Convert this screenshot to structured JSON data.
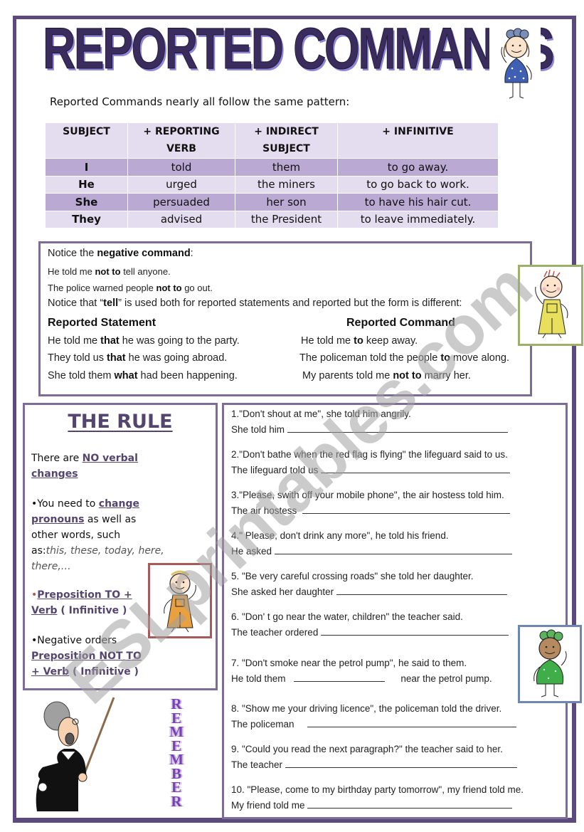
{
  "title": "REPORTED COMMANDS",
  "intro": "Reported Commands nearly all follow the same pattern:",
  "pattern_table": {
    "headers": [
      "SUBJECT",
      "+ REPORTING VERB",
      "+ INDIRECT SUBJECT",
      "+ INFINITIVE"
    ],
    "rows": [
      [
        "I",
        "told",
        "them",
        "to go away."
      ],
      [
        "He",
        "urged",
        "the miners",
        "to go back to work."
      ],
      [
        "She",
        "persuaded",
        "her son",
        "to have his hair cut."
      ],
      [
        "They",
        "advised",
        "the President",
        "to leave immediately."
      ]
    ]
  },
  "notice": {
    "negative_intro_pre": "Notice the ",
    "negative_intro_bold": "negative command",
    "negative_intro_post": ":",
    "example1_pre": "He told me ",
    "example1_bold": "not to",
    "example1_post": " tell anyone.",
    "example2_pre": "The police warned people ",
    "example2_bold": "not  to",
    "example2_post": " go out.",
    "tell_pre": "Notice that “",
    "tell_bold": "tell",
    "tell_post": "” is used both for reported statements and reported but the form is different:",
    "statement_heading": "Reported Statement",
    "command_heading": "Reported Command",
    "statements": [
      {
        "pre": "He told me ",
        "bold": "that",
        "post": " he was going to the party."
      },
      {
        "pre": "They told us ",
        "bold": "that",
        "post": " he was going abroad."
      },
      {
        "pre": "She told them ",
        "bold": "what",
        "post": " had been happening."
      }
    ],
    "commands": [
      {
        "pre": "He told me ",
        "bold": "to",
        "post": " keep away."
      },
      {
        "pre": "The policeman told the people ",
        "bold": "to",
        "post": " move along."
      },
      {
        "pre": "My parents told me ",
        "bold": "not to",
        "post": " marry her."
      }
    ]
  },
  "rule": {
    "title": "THE RULE",
    "p1_pre": "There are ",
    "p1_u1": "NO verbal",
    "p1_u2": "changes",
    "p2_pre": "•You need to ",
    "p2_u1": "change",
    "p2_u2": "pronouns",
    "p2_mid": " as well as",
    "p2_line3": "other words, such",
    "p2_as": "as:",
    "p2_examples1": "this, these, today, here,",
    "p2_examples2": "there,…",
    "p3_bullet": "•",
    "p3_u1": "Preposition TO +",
    "p3_u2": "Verb",
    "p3_post": " ( Infinitive )",
    "p4_line1": "•Negative orders",
    "p4_u1": "Preposition NOT TO",
    "p4_u2": "+ Verb",
    "p4_post": " ( Infinitive )"
  },
  "exercises": [
    {
      "question": "1.\"Don't shout at me\", she told him  angrily.",
      "prompt": "She told him",
      "suffix": ""
    },
    {
      "question": "2.\"Don't bathe when the red flag is flying\" the lifeguard said to us.",
      "prompt": "The lifeguard told us",
      "suffix": ""
    },
    {
      "question": "3.\"Please, swith off your mobile phone\", the air hostess told him.",
      "prompt": "The air hostess",
      "suffix": ""
    },
    {
      "question": "4.\" Please, don't drink any more\", he told his friend.",
      "prompt": "He asked",
      "suffix": ""
    },
    {
      "question": "5. \"Be very careful crossing roads\" she told her daughter.",
      "prompt": "She asked her daughter",
      "suffix": ""
    },
    {
      "question": "6. \"Don' t go near the water, children\" the teacher said.",
      "prompt": "The teacher ordered",
      "suffix": ""
    },
    {
      "question": "7. \"Don't smoke near the petrol pump\", he said to them.",
      "prompt": "He told them",
      "suffix": "near  the petrol pump."
    },
    {
      "question": "8. \"Show me your driving licence\", the policeman told the driver.",
      "prompt": "The policeman",
      "suffix": ""
    },
    {
      "question": "9. \"Could you read the next paragraph?\" the teacher said to her.",
      "prompt": "The teacher",
      "suffix": ""
    },
    {
      "question": "10. \"Please, come to my birthday party tomorrow\", my friend told me.",
      "prompt": "My friend told me",
      "suffix": ""
    }
  ],
  "remember_letters": [
    "R",
    "E",
    "M",
    "E",
    "M",
    "B",
    "E",
    "R"
  ],
  "watermark": "ESLprintables.com",
  "colors": {
    "frame": "#5c4a7c",
    "box_border": "#7e6c98",
    "table_dark": "#b9a9d3",
    "table_light": "#e4dcef",
    "title": "#3a2c5c",
    "rule_accent": "#54456f"
  }
}
